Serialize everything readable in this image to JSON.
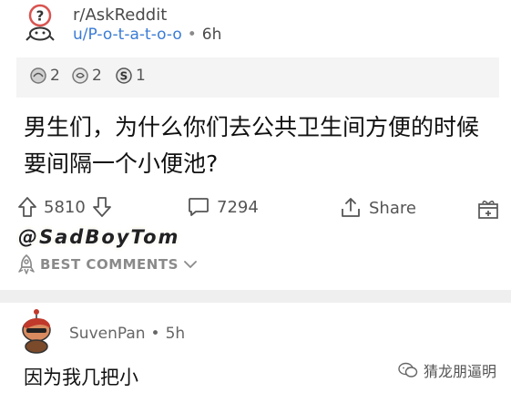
{
  "post": {
    "subreddit": "r/AskReddit",
    "author": "u/P-o-t-a-t-o-o",
    "time": "6h",
    "separator": "•"
  },
  "awards": [
    {
      "icon": "silver-award-icon",
      "count": "2"
    },
    {
      "icon": "helpful-award-icon",
      "count": "2"
    },
    {
      "icon": "coin-award-icon",
      "count": "1"
    }
  ],
  "title": "男生们，为什么你们去公共卫生间方便的时候要间隔一个小便池?",
  "actions": {
    "upvotes": "5810",
    "comments": "7294",
    "share": "Share"
  },
  "watermark": "@SadBoyTom",
  "sort": {
    "label": "BEST COMMENTS"
  },
  "comment": {
    "author": "SuvenPan",
    "time": "5h",
    "separator": "•",
    "body": "因为我几把小"
  },
  "wechat_watermark": "猜龙朋逼明",
  "colors": {
    "user_link": "#3a7bd5",
    "awards_bg": "#f4f4f4",
    "divider": "#efefef",
    "icon_gray": "#555555"
  }
}
